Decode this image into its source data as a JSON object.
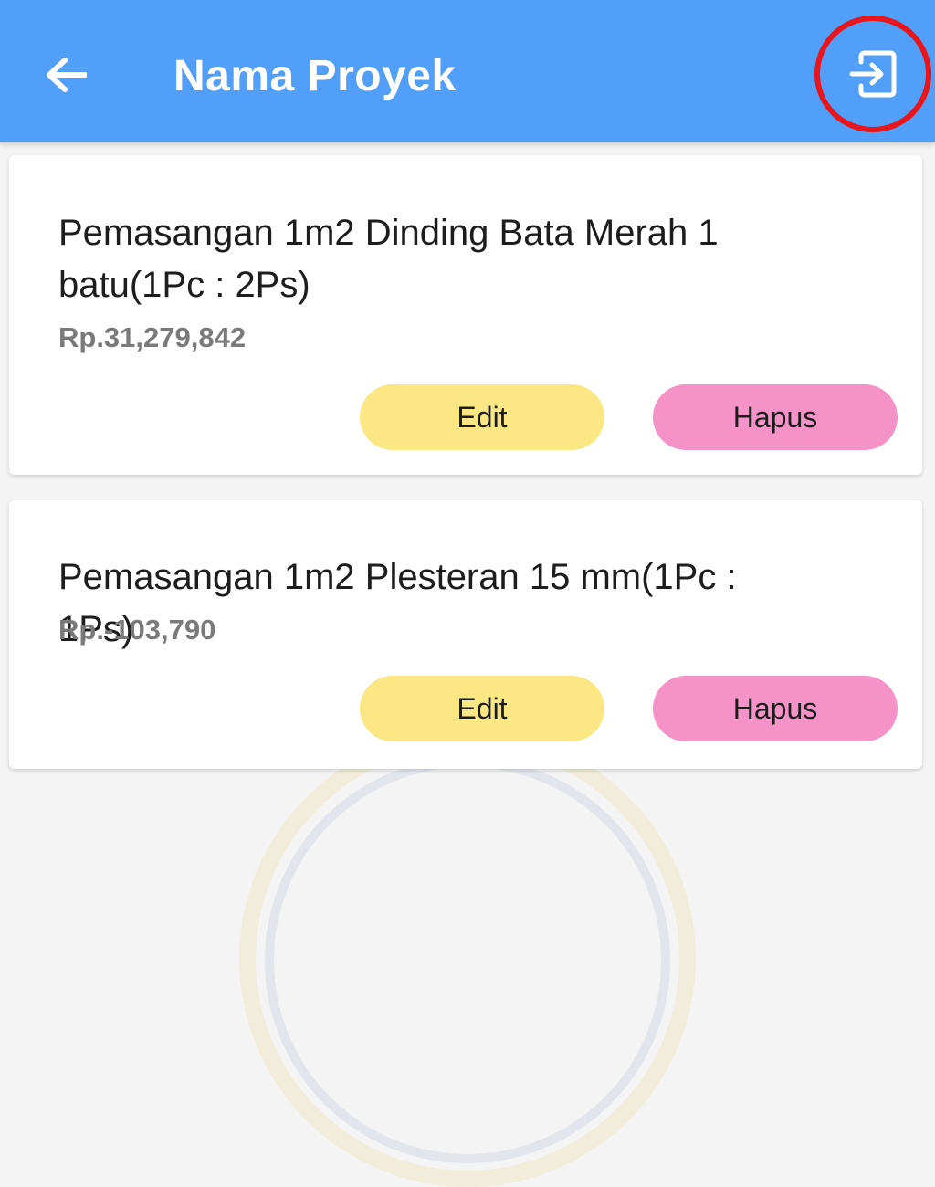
{
  "header": {
    "title": "Nama Proyek",
    "back_icon": "arrow-left-icon",
    "logout_icon": "logout-icon",
    "background_color": "#519ff8",
    "highlight_color": "#e8151b"
  },
  "items": [
    {
      "name": "Pemasangan 1m2 Dinding Bata Merah 1 batu(1Pc : 2Ps)",
      "price": "Rp.31,279,842",
      "edit_label": "Edit",
      "delete_label": "Hapus"
    },
    {
      "name": "Pemasangan 1m2 Plesteran 15 mm(1Pc : 1Ps)",
      "price": "Rp.-103,790",
      "edit_label": "Edit",
      "delete_label": "Hapus"
    }
  ],
  "colors": {
    "edit_button": "#fbe784",
    "delete_button": "#f592c7"
  }
}
